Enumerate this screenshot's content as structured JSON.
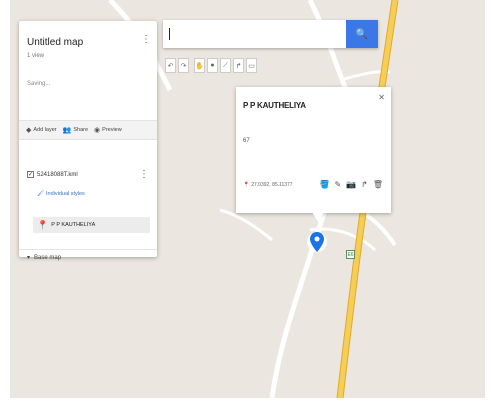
{
  "map": {
    "title": "Untitled map",
    "views": "1 view",
    "status": "Saving...",
    "toolbar": {
      "add_layer": "Add layer",
      "share": "Share",
      "preview": "Preview"
    },
    "layer": {
      "name": "52418088T.kml",
      "styles": "Individual styles",
      "feature": "P P KAUTHELIYA"
    },
    "base_map": "Base map"
  },
  "search": {
    "placeholder": "",
    "value": ""
  },
  "popup": {
    "title": "P P KAUTHELIYA",
    "description": "67",
    "coords": "27.0392, 85.11377"
  },
  "road_sign": "E6",
  "colors": {
    "map_bg": "#ebe6df",
    "highway": "#f3c54b",
    "accent": "#3b78e7",
    "marker": "#1a73e8"
  }
}
